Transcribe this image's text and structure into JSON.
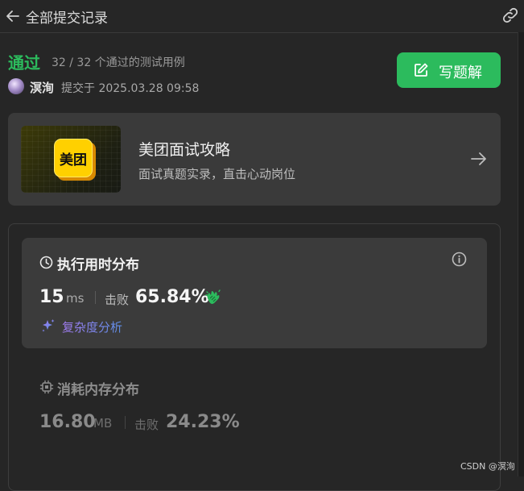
{
  "header": {
    "title": "全部提交记录",
    "back_icon": "arrow-left-icon",
    "share_icon": "link-icon"
  },
  "submission": {
    "status": "通过",
    "status_color": "#2cbb5d",
    "testcases": "32 / 32 个通过的测试用例",
    "user": "溟洵",
    "submitted_at": "提交于 2025.03.28 09:58"
  },
  "actions": {
    "solution_label": "写题解",
    "solution_icon": "edit-icon",
    "accent": "#2cbb5d"
  },
  "promo": {
    "logo_text": "美团",
    "title": "美团面试攻略",
    "subtitle": "面试真题实录，直击心动岗位",
    "arrow_icon": "arrow-right-icon"
  },
  "runtime": {
    "title": "执行用时分布",
    "value": "15",
    "unit": "ms",
    "beats_label": "击败",
    "beats_value": "65.84%",
    "icons": [
      "clock-icon",
      "info-icon",
      "clap-icon",
      "sparkle-icon"
    ],
    "complexity_link": "复杂度分析"
  },
  "memory": {
    "title": "消耗内存分布",
    "value": "16.80",
    "unit": "MB",
    "beats_label": "击败",
    "beats_value": "24.23%"
  },
  "watermark": "CSDN @溟洵"
}
